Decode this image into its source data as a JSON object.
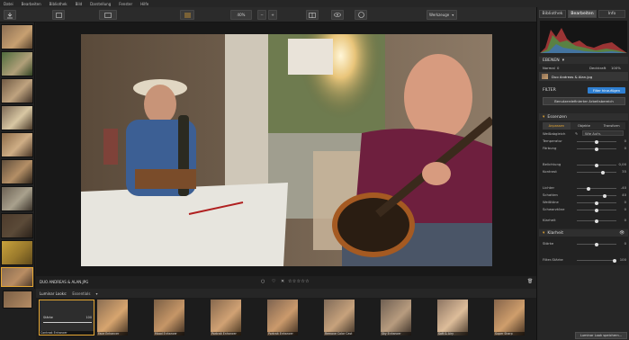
{
  "menu": [
    "Datei",
    "Bearbeiten",
    "Bibliothek",
    "Bild",
    "Darstellung",
    "Fenster",
    "Hilfe"
  ],
  "toolbar": {
    "zoom": "40%",
    "compare_label": "Werkzeuge"
  },
  "right_tabs": [
    "Bibliothek",
    "Bearbeiten",
    "Info"
  ],
  "right_tab_selected": 1,
  "layers": {
    "title": "EBENEN",
    "mode": "Normal",
    "mode_value": "0",
    "opacity_label": "Deckkraft",
    "opacity_value": "100%",
    "file_name": "Duo Andreas & Alan.jpg"
  },
  "filter": {
    "title": "FILTER",
    "add_button": "Filter hinzufügen",
    "workspace_button": "Benutzerdefinierter Arbeitsbereich"
  },
  "essentials": {
    "title": "Essenzen",
    "tabs": [
      "Anpassen",
      "Objekte",
      "Transform"
    ],
    "wb_label": "Weißabgleich",
    "wb_value": "Wie Aufn.",
    "sliders": [
      {
        "label": "Temperatur",
        "value": "0",
        "pos": 0.5
      },
      {
        "label": "Färbung",
        "value": "0",
        "pos": 0.5
      },
      {
        "label": "Belichtung",
        "value": "0,00",
        "pos": 0.5
      },
      {
        "label": "Kontrast",
        "value": "35",
        "pos": 0.67
      },
      {
        "label": "Lichter",
        "value": "-40",
        "pos": 0.3
      },
      {
        "label": "Schatten",
        "value": "40",
        "pos": 0.7
      },
      {
        "label": "Weißtöne",
        "value": "0",
        "pos": 0.5
      },
      {
        "label": "Schwarztöne",
        "value": "0",
        "pos": 0.5
      },
      {
        "label": "Klarheit",
        "value": "0",
        "pos": 0.5
      }
    ]
  },
  "vignette": {
    "title": "Klarheit",
    "strength_label": "Stärke",
    "strength_value": "0",
    "filter_strength_label": "Filter-Stärke",
    "filter_strength_value": "100"
  },
  "bottom_button": "Luminar Look speichern...",
  "status": {
    "filename": "DUO ANDREAS & ALAN.JPG",
    "rating": "☆☆☆☆☆"
  },
  "looks": {
    "header": "Luminar Looks:",
    "category": "Essentials",
    "items": [
      "Contrast Enhancer",
      "Face Enhancer",
      "Mood Enhancer",
      "Portrait Enhancer",
      "Portrait Enhancer",
      "Remove Color Cast",
      "Sky Enhancer",
      "Soft & Airy",
      "Super Sharp"
    ],
    "first_slider_label": "Stärke",
    "first_slider_value": "100"
  },
  "colors": {
    "accent": "#e6a733",
    "blue_button": "#2f7fd1"
  }
}
